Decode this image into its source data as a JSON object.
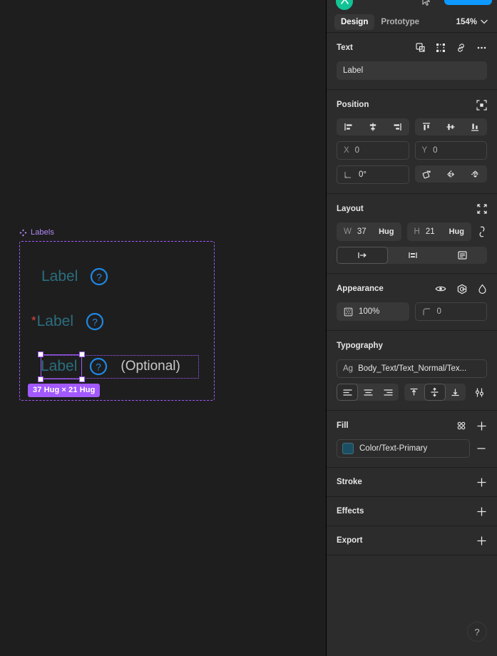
{
  "panel": {
    "top": {
      "avatar_icon": "user-avatar",
      "cursor_icon": "cursor-icon",
      "share_button": ""
    },
    "tabs": [
      {
        "label": "Design",
        "active": true
      },
      {
        "label": "Prototype",
        "active": false
      }
    ],
    "zoom": {
      "value": "154%",
      "chevron": "chevron-down-icon"
    },
    "text_section": {
      "title": "Text",
      "icons": [
        "create-component-icon",
        "component-set-icon",
        "link-icon",
        "more-options-icon"
      ],
      "name_value": "Label"
    },
    "position": {
      "title": "Position",
      "target_icon": "absolute-position-icon",
      "align_horizontal": [
        "align-left-icon",
        "align-horizontal-center-icon",
        "align-right-icon"
      ],
      "align_vertical": [
        "align-top-icon",
        "align-vertical-center-icon",
        "align-bottom-icon"
      ],
      "x_label": "X",
      "x_value": "0",
      "y_label": "Y",
      "y_value": "0",
      "rotation_value": "0°",
      "transform_icons": [
        "rotate-icon",
        "flip-horizontal-icon",
        "flip-vertical-icon"
      ]
    },
    "layout": {
      "title": "Layout",
      "collapse_icon": "collapse-icon",
      "w_label": "W",
      "w_value": "37",
      "w_mode": "Hug",
      "h_label": "H",
      "h_value": "21",
      "h_mode": "Hug",
      "chain_icon": "aspect-ratio-lock-icon",
      "resize_icons": [
        "auto-width-icon",
        "fixed-width-icon",
        "text-truncate-icon"
      ]
    },
    "appearance": {
      "title": "Appearance",
      "icons": [
        "visibility-eye-icon",
        "blend-mode-icon",
        "drop-shadow-icon"
      ],
      "opacity_value": "100%",
      "opacity_icon": "opacity-icon",
      "corner_value": "0",
      "corner_icon": "corner-radius-icon"
    },
    "typography": {
      "title": "Typography",
      "style_prefix": "Ag",
      "style_name": "Body_Text/Text_Normal/Tex...",
      "align_h_icons": [
        "text-align-left-icon",
        "text-align-center-icon",
        "text-align-right-icon"
      ],
      "align_v_icons": [
        "text-align-top-icon",
        "text-align-middle-icon",
        "text-align-bottom-icon"
      ],
      "settings_icon": "type-settings-icon"
    },
    "fill": {
      "title": "Fill",
      "styles_icon": "fill-styles-icon",
      "add_icon": "add-fill-icon",
      "swatch_color": "#1a4f63",
      "style_name": "Color/Text-Primary",
      "remove_icon": "remove-fill-icon"
    },
    "collapsed_sections": [
      {
        "title": "Stroke",
        "add_icon": "add-stroke-icon"
      },
      {
        "title": "Effects",
        "add_icon": "add-effect-icon"
      },
      {
        "title": "Export",
        "add_icon": "add-export-icon"
      }
    ],
    "help_fab": {
      "glyph": "?",
      "icon": "help-icon"
    }
  },
  "canvas": {
    "component_name": "Labels",
    "component_icon": "component-diamond-icon",
    "accent_purple": "#a259ff",
    "label_color": "#2b6e7f",
    "help_icon_color": "#1e88e5",
    "required_color": "#d9463f",
    "rows": [
      {
        "required": false,
        "label": "Label",
        "help": "?",
        "optional": ""
      },
      {
        "required": true,
        "required_mark": "*",
        "label": "Label",
        "help": "?",
        "optional": ""
      },
      {
        "required": false,
        "label": "Label",
        "help": "?",
        "optional": "(Optional)"
      }
    ],
    "selection_badge": "37 Hug × 21 Hug"
  }
}
